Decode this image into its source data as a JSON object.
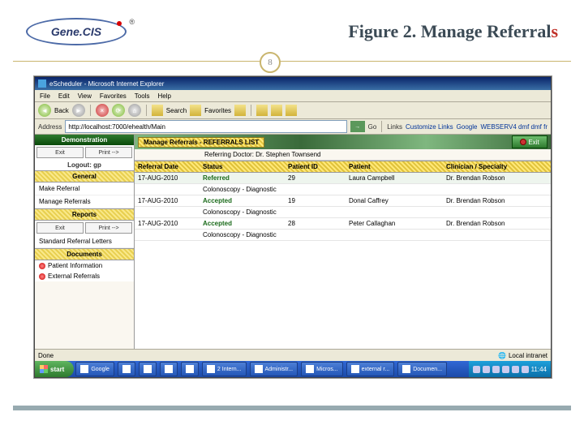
{
  "slide": {
    "title_main": "Figure 2. Manage Referral",
    "title_accent": "s",
    "page_number": "8",
    "logo_text": "Gene.CIS"
  },
  "browser": {
    "window_title": "eScheduler - Microsoft Internet Explorer",
    "menus": [
      "File",
      "Edit",
      "View",
      "Favorites",
      "Tools",
      "Help"
    ],
    "toolbar": {
      "back": "Back",
      "search": "Search",
      "favorites": "Favorites"
    },
    "address_label": "Address",
    "address_value": "http://localhost:7000/ehealth/Main",
    "go": "Go",
    "links_label": "Links",
    "link1": "Customize Links",
    "link2": "Google",
    "link3": "WEBSERV4 dmf dmf fr",
    "status": "Done",
    "zone": "Local intranet"
  },
  "sidebar": {
    "header": "Demonstration",
    "exit": "Exit",
    "print": "Print -->",
    "logout": "Logout: gp",
    "sections": {
      "general": "General",
      "reports": "Reports",
      "documents": "Documents"
    },
    "general_items": [
      "Make Referral",
      "Manage Referrals"
    ],
    "reports_items": [
      "Standard Referral Letters"
    ],
    "documents_items": [
      "Patient Information",
      "External Referrals"
    ]
  },
  "panel": {
    "title": "Manage Referrals - REFERRALS LIST",
    "exit": "Exit",
    "subheader_label": "Referring Doctor:",
    "subheader_value": "Dr. Stephen Townsend",
    "columns": {
      "date": "Referral Date",
      "status": "Status",
      "pid": "Patient ID",
      "patient": "Patient",
      "clinician": "Clinician / Specialty"
    },
    "rows": [
      {
        "date": "17-AUG-2010",
        "status": "Referred",
        "pid": "29",
        "patient": "Laura Campbell",
        "clinician": "Dr. Brendan Robson",
        "procedure": "Colonoscopy - Diagnostic"
      },
      {
        "date": "17-AUG-2010",
        "status": "Accepted",
        "pid": "19",
        "patient": "Donal Caffrey",
        "clinician": "Dr. Brendan Robson",
        "procedure": "Colonoscopy - Diagnostic"
      },
      {
        "date": "17-AUG-2010",
        "status": "Accepted",
        "pid": "28",
        "patient": "Peter Callaghan",
        "clinician": "Dr. Brendan Robson",
        "procedure": "Colonoscopy - Diagnostic"
      }
    ]
  },
  "taskbar": {
    "start": "start",
    "items": [
      "Google",
      "",
      "",
      "",
      "",
      "2 Intern...",
      "Administr...",
      "Micros...",
      "external r...",
      "Documen..."
    ],
    "clock": "11:44"
  }
}
